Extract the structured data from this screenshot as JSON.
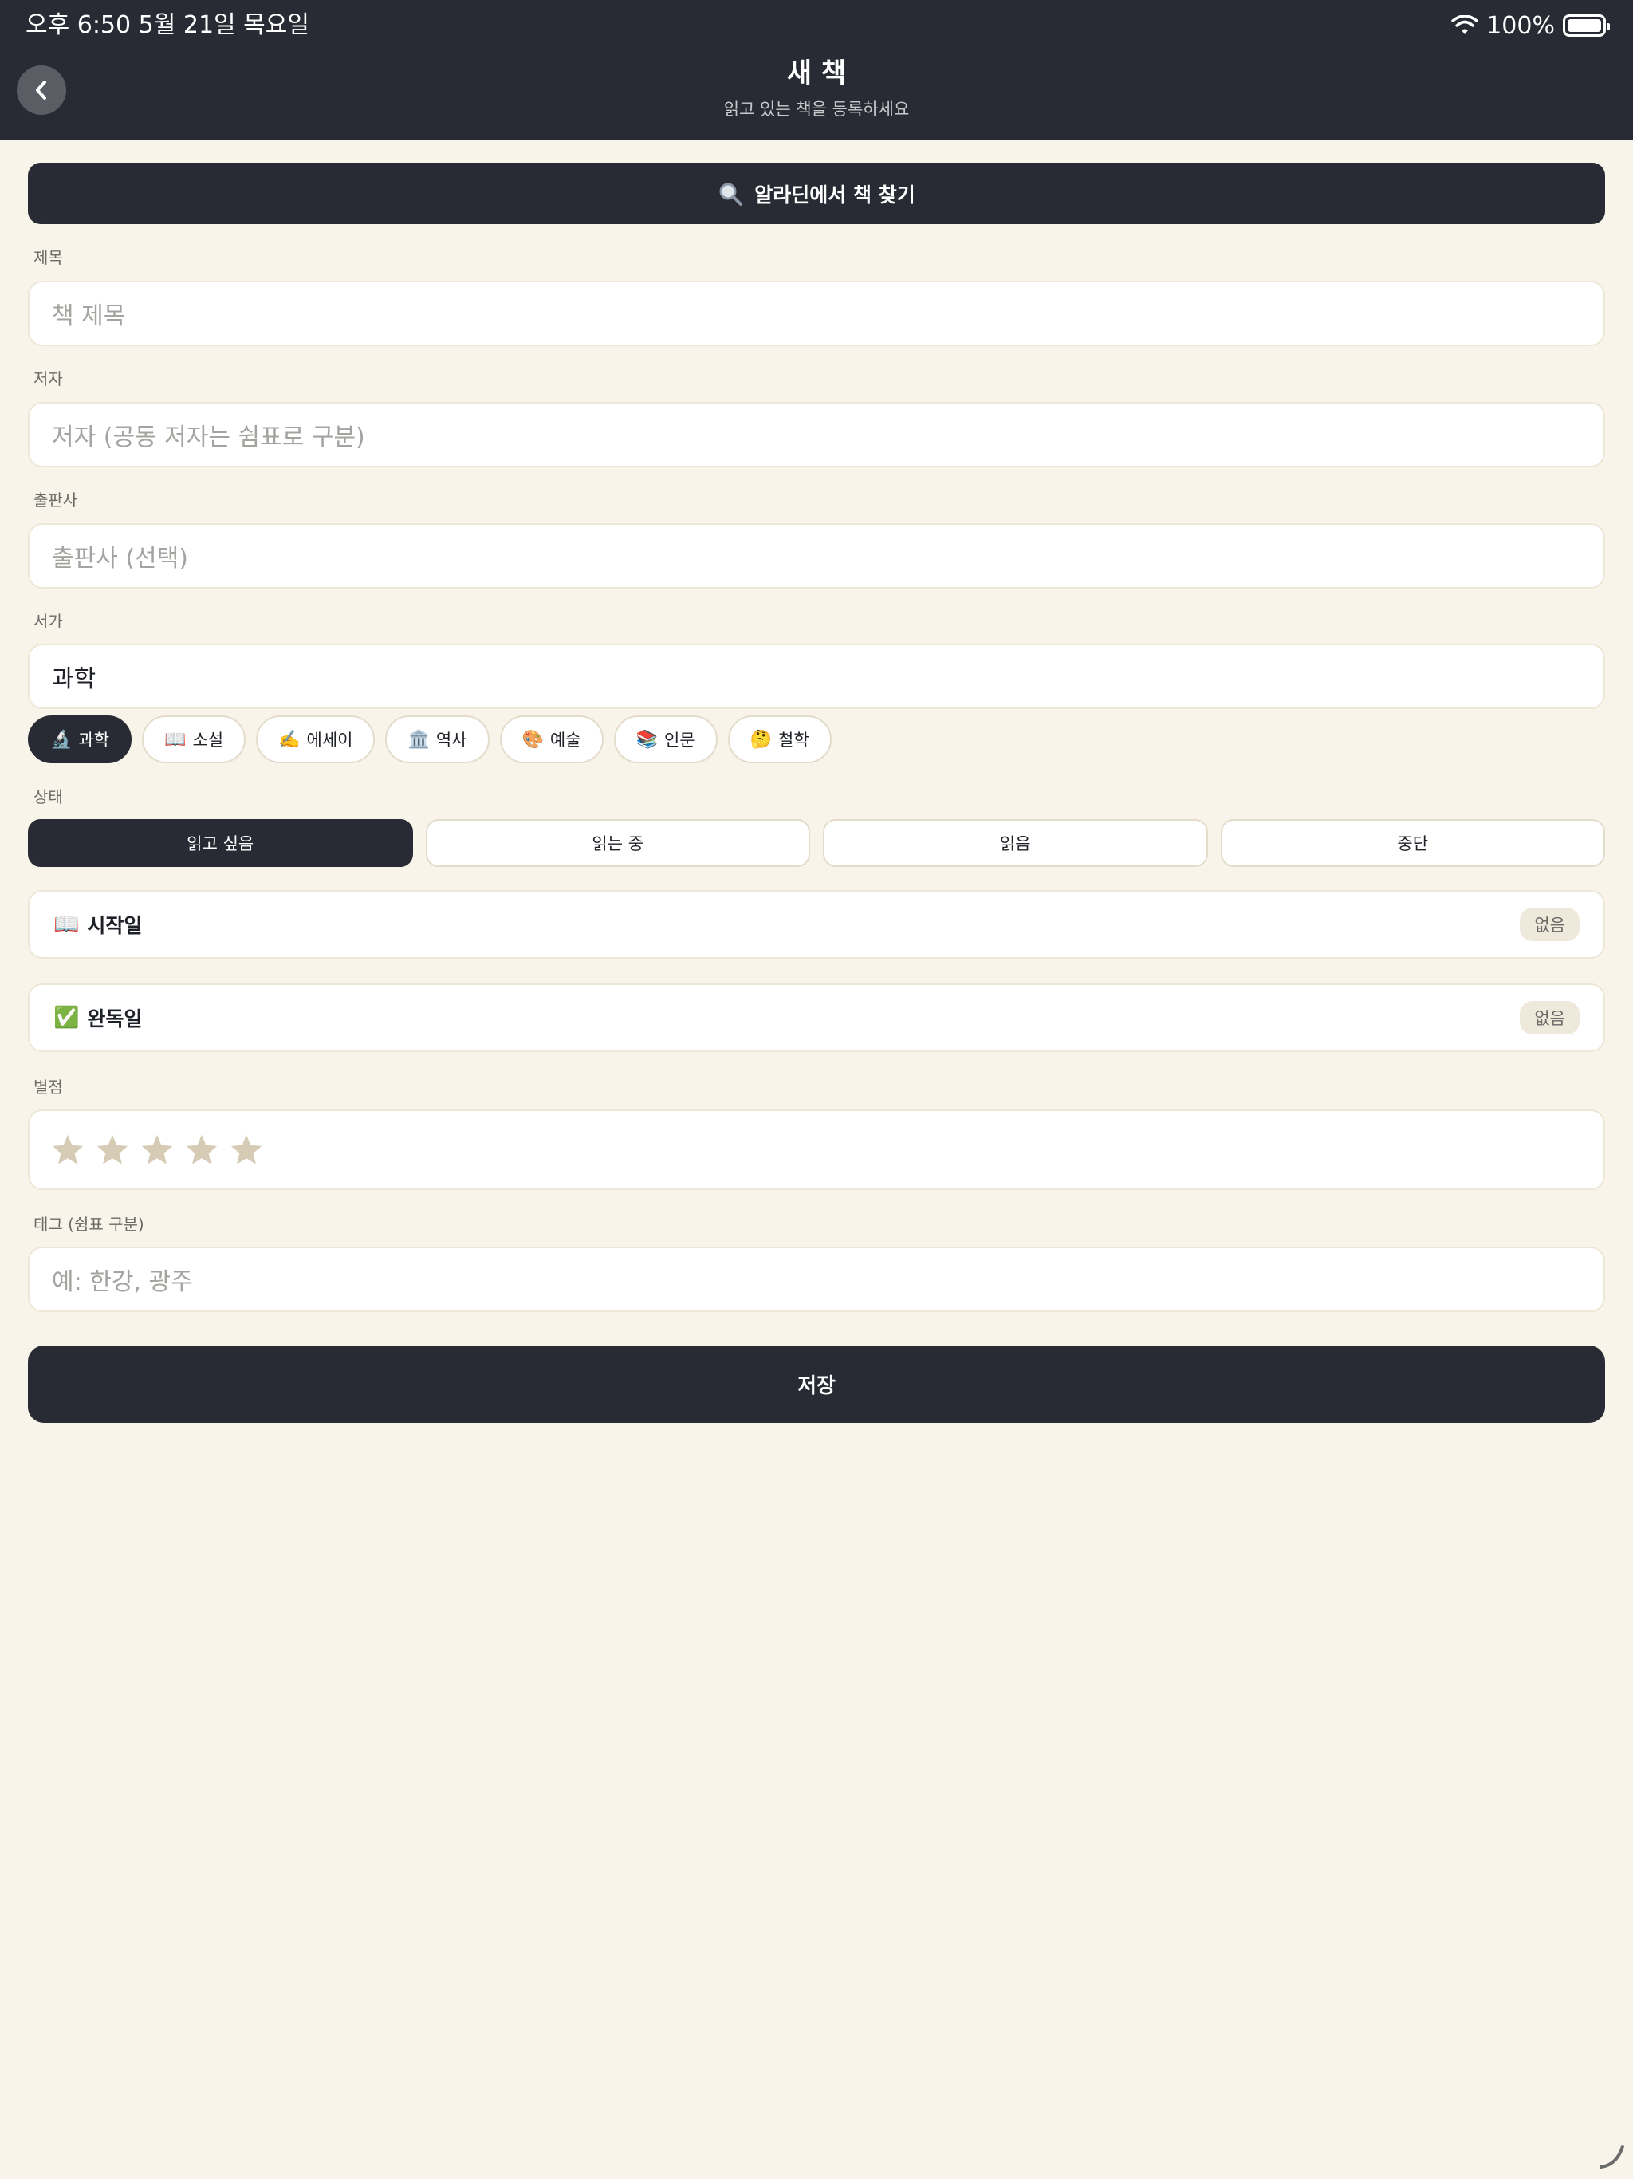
{
  "status_bar": {
    "time_date": "오후 6:50   5월 21일 목요일",
    "battery": "100%"
  },
  "header": {
    "title": "새 책",
    "subtitle": "읽고 있는 책을 등록하세요",
    "back_icon": "chevron-left-icon"
  },
  "search": {
    "label": "알라딘에서 책 찾기",
    "icon": "magnifying-glass-icon"
  },
  "form": {
    "title_label": "제목",
    "title_placeholder": "책 제목",
    "author_label": "저자",
    "author_placeholder": "저자 (공동 저자는 쉼표로 구분)",
    "publisher_label": "출판사",
    "publisher_placeholder": "출판사 (선택)",
    "shelf_label": "서가",
    "shelf_value": "과학",
    "status_label": "상태",
    "rating_label": "별점",
    "rating_value": 0,
    "rating_max": 5,
    "tags_label": "태그 (쉼표 구분)",
    "tags_placeholder": "예: 한강, 광주"
  },
  "shelves": [
    {
      "emoji": "🔬",
      "label": "과학",
      "selected": true
    },
    {
      "emoji": "📖",
      "label": "소설",
      "selected": false
    },
    {
      "emoji": "✍️",
      "label": "에세이",
      "selected": false
    },
    {
      "emoji": "🏛️",
      "label": "역사",
      "selected": false
    },
    {
      "emoji": "🎨",
      "label": "예술",
      "selected": false
    },
    {
      "emoji": "📚",
      "label": "인문",
      "selected": false
    },
    {
      "emoji": "🤔",
      "label": "철학",
      "selected": false
    }
  ],
  "statuses": [
    {
      "label": "읽고 싶음",
      "selected": true
    },
    {
      "label": "읽는 중",
      "selected": false
    },
    {
      "label": "읽음",
      "selected": false
    },
    {
      "label": "중단",
      "selected": false
    }
  ],
  "dates": {
    "start": {
      "emoji": "📖",
      "label": "시작일",
      "value": "없음"
    },
    "finish": {
      "emoji": "✅",
      "label": "완독일",
      "value": "없음"
    }
  },
  "save_label": "저장",
  "colors": {
    "background": "#f9f4ea",
    "dark": "#282b33",
    "star_empty": "#d6ccb6"
  }
}
